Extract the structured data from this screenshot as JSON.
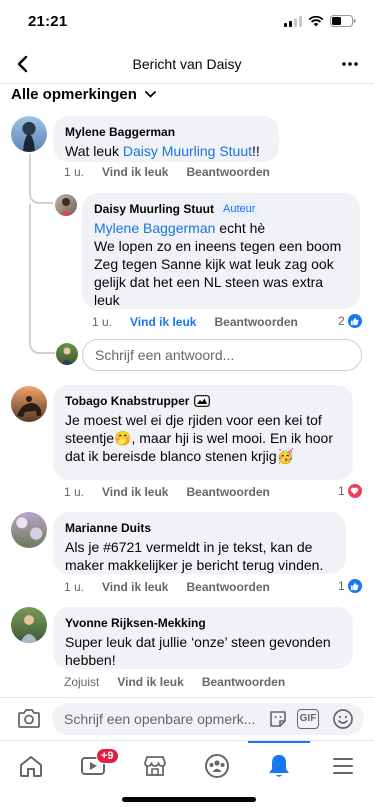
{
  "status_bar": {
    "time": "21:21"
  },
  "header": {
    "title": "Bericht van Daisy"
  },
  "filter": {
    "label": "Alle opmerkingen"
  },
  "comments": [
    {
      "author": "Mylene Baggerman",
      "text_prefix": "Wat leuk ",
      "mention": "Daisy Muurling Stuut",
      "text_suffix": "!!",
      "time": "1 u.",
      "like": "Vind ik leuk",
      "reply": "Beantwoorden"
    },
    {
      "author": "Daisy Muurling Stuut",
      "badge": "Auteur",
      "mention": "Mylene Baggerman",
      "text_suffix": " echt hè",
      "lines": [
        "We lopen zo en ineens tegen een boom",
        "Zeg tegen Sanne kijk wat leuk zag ook",
        "gelijk dat het een NL steen was extra",
        "leuk"
      ],
      "time": "1 u.",
      "like": "Vind ik leuk",
      "reply": "Beantwoorden",
      "reactions": "2"
    },
    {
      "author": "Tobago Knabstrupper",
      "lines": [
        "Je moest wel ei dje rjiden voor een kei tof",
        "steentje🤭, maar hji is wel mooi. En ik hoor",
        "dat ik bereisde blanco stenen krjig🥳"
      ],
      "time": "1 u.",
      "like": "Vind ik leuk",
      "reply": "Beantwoorden",
      "reactions": "1"
    },
    {
      "author": "Marianne Duits",
      "lines": [
        "Als je #6721 vermeldt in je tekst, kan de",
        "maker makkelijker je bericht terug vinden."
      ],
      "time": "1 u.",
      "like": "Vind ik leuk",
      "reply": "Beantwoorden",
      "reactions": "1"
    },
    {
      "author": "Yvonne Rijksen-Mekking",
      "lines": [
        "Super leuk dat jullie ‘onze’ steen gevonden",
        "hebben!"
      ],
      "time": "Zojuist",
      "like": "Vind ik leuk",
      "reply": "Beantwoorden"
    }
  ],
  "reply_input": {
    "placeholder": "Schrijf een antwoord..."
  },
  "composer": {
    "placeholder": "Schrijf een openbare opmerk...",
    "gif_label": "GIF"
  },
  "tabbar": {
    "video_badge": "+9",
    "tabs": [
      "home-icon",
      "video-icon",
      "marketplace-icon",
      "groups-icon",
      "notifications-icon",
      "menu-icon"
    ],
    "active": "notifications-icon"
  },
  "colors": {
    "accent": "#1877f2",
    "bubble": "#f0f2f5",
    "muted": "#65676b",
    "love": "#f33e58"
  }
}
